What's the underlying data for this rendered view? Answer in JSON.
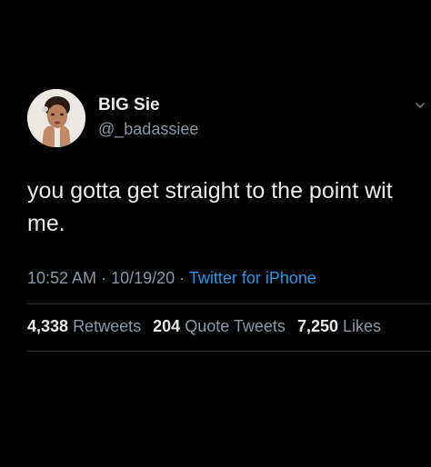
{
  "tweet": {
    "author": {
      "display_name": "BIG Sie",
      "handle": "@_badassiee",
      "avatar": "profile-photo"
    },
    "text": "you gotta get straight to the point wit me.",
    "timestamp_time": "10:52 AM",
    "timestamp_date": "10/19/20",
    "source": "Twitter for iPhone",
    "stats": {
      "retweets_count": "4,338",
      "retweets_label": "Retweets",
      "quote_tweets_count": "204",
      "quote_tweets_label": "Quote Tweets",
      "likes_count": "7,250",
      "likes_label": "Likes"
    }
  },
  "icons": {
    "more": "chevron-down-icon"
  },
  "colors": {
    "background": "#000000",
    "text": "#e7e9ea",
    "secondary": "#8b98a5",
    "link": "#1d9bf0",
    "divider": "#2f3336"
  }
}
